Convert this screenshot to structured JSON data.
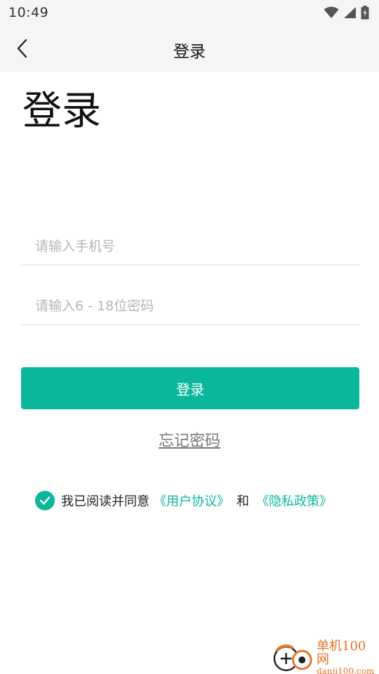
{
  "status_bar": {
    "time": "10:49"
  },
  "app_bar": {
    "title": "登录"
  },
  "page": {
    "heading": "登录"
  },
  "form": {
    "phone_placeholder": "请输入手机号",
    "phone_value": "",
    "password_placeholder": "请输入6 - 18位密码",
    "password_value": "",
    "login_button_label": "登录",
    "forgot_password_label": "忘记密码"
  },
  "agreement": {
    "checked": true,
    "prefix": "我已阅读并同意",
    "user_agreement_link": "《用户协议》",
    "and_text": "和",
    "privacy_policy_link": "《隐私政策》"
  },
  "watermark": {
    "name": "单机100网",
    "url": "danji100.com"
  },
  "colors": {
    "accent": "#0bb79b",
    "status_bar_bg": "#f5f5f5",
    "placeholder": "#b5b5b5",
    "watermark": "#e8742a"
  }
}
